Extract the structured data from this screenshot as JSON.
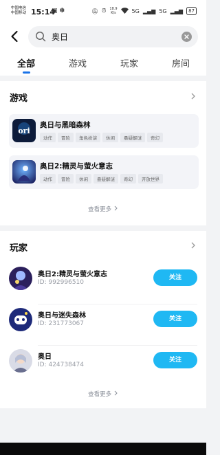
{
  "status_bar": {
    "carrier_1": "中国电信",
    "carrier_2": "中国移动",
    "time": "15:14",
    "net_speed_value": "18.9",
    "net_speed_unit": "K/s",
    "signal_1": "5G",
    "signal_2": "5G",
    "battery": "87"
  },
  "search": {
    "query": "奥日"
  },
  "tabs": [
    {
      "label": "全部",
      "active": true
    },
    {
      "label": "游戏",
      "active": false
    },
    {
      "label": "玩家",
      "active": false
    },
    {
      "label": "房间",
      "active": false
    }
  ],
  "games_section": {
    "title": "游戏",
    "games": [
      {
        "name": "奥日与黑暗森林",
        "tags": [
          "动作",
          "冒险",
          "角色扮演",
          "休闲",
          "悬疑解谜",
          "奇幻"
        ]
      },
      {
        "name": "奥日2:精灵与萤火意志",
        "tags": [
          "动作",
          "冒险",
          "休闲",
          "悬疑解谜",
          "奇幻",
          "开放世界"
        ]
      }
    ],
    "more_label": "查看更多"
  },
  "players_section": {
    "title": "玩家",
    "players": [
      {
        "name": "奥日2:精灵与萤火意志",
        "id_text": "ID: 992996510",
        "follow_label": "关注"
      },
      {
        "name": "奥日与迷失森林",
        "id_text": "ID: 231773067",
        "follow_label": "关注"
      },
      {
        "name": "奥日",
        "id_text": "ID: 424738474",
        "follow_label": "关注"
      }
    ],
    "more_label": "查看更多"
  },
  "colors": {
    "accent": "#1a73e8",
    "follow_button": "#1fb8f3"
  }
}
